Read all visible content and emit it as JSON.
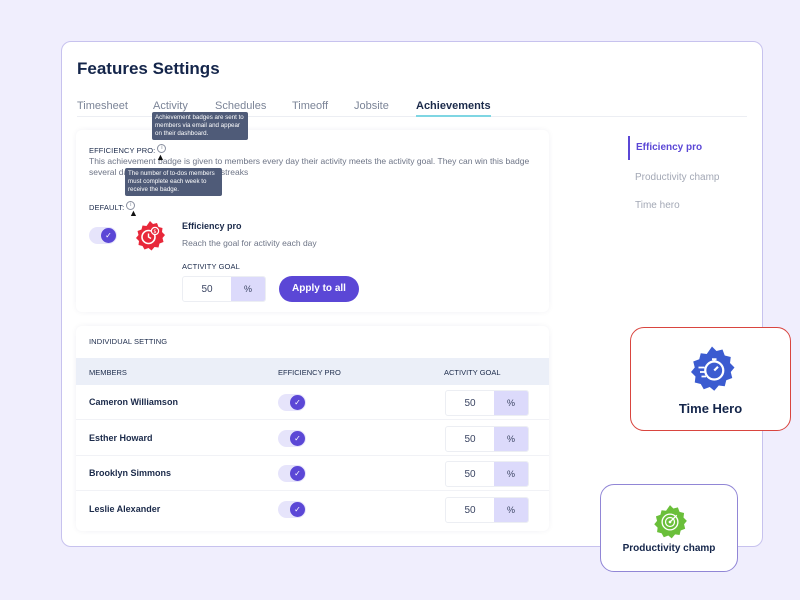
{
  "page": {
    "title": "Features Settings"
  },
  "tabs": [
    {
      "label": "Timesheet",
      "active": false
    },
    {
      "label": "Activity",
      "active": false
    },
    {
      "label": "Schedules",
      "active": false
    },
    {
      "label": "Timeoff",
      "active": false
    },
    {
      "label": "Jobsite",
      "active": false
    },
    {
      "label": "Achievements",
      "active": true
    }
  ],
  "achievement": {
    "section_label": "EFFICIENCY PRO:",
    "description": "This achievement badge is given to members every day their activity meets the activity goal. They can win this badge several days in a row to create hot streaks",
    "default_label": "DEFAULT:",
    "tooltip_section": "Achievement badges are sent to members via email and appear on their dashboard.",
    "tooltip_default": "The number of to-dos members must complete each week to receive the badge.",
    "toggle_on": true,
    "toggle_icon": "check-icon",
    "badge_icon": "stopwatch-dollar-badge-icon",
    "badge_name": "Efficiency pro",
    "badge_desc": "Reach the goal for activity each day",
    "goal_label": "ACTIVITY GOAL",
    "goal_value": "50",
    "goal_unit": "%",
    "apply_button": "Apply to all"
  },
  "individual": {
    "section_label": "INDIVIDUAL SETTING",
    "columns": [
      "MEMBERS",
      "EFFICIENCY PRO",
      "ACTIVITY GOAL"
    ],
    "rows": [
      {
        "name": "Cameron Williamson",
        "enabled": true,
        "goal": "50",
        "unit": "%"
      },
      {
        "name": "Esther Howard",
        "enabled": true,
        "goal": "50",
        "unit": "%"
      },
      {
        "name": "Brooklyn Simmons",
        "enabled": true,
        "goal": "50",
        "unit": "%"
      },
      {
        "name": "Leslie Alexander",
        "enabled": true,
        "goal": "50",
        "unit": "%"
      }
    ]
  },
  "side_nav": [
    {
      "label": "Efficiency pro",
      "active": true
    },
    {
      "label": "Productivity champ",
      "active": false
    },
    {
      "label": "Time hero",
      "active": false
    }
  ],
  "badges": {
    "time_hero": {
      "title": "Time Hero",
      "icon": "stopwatch-speed-badge-icon",
      "color": "#3b5bd0"
    },
    "productivity": {
      "title": "Productivity champ",
      "icon": "target-badge-icon",
      "color": "#6abf3a"
    }
  },
  "colors": {
    "accent": "#5b47d6",
    "tab_underline": "#7fd6e3",
    "efficiency_badge": "#e8283a"
  }
}
